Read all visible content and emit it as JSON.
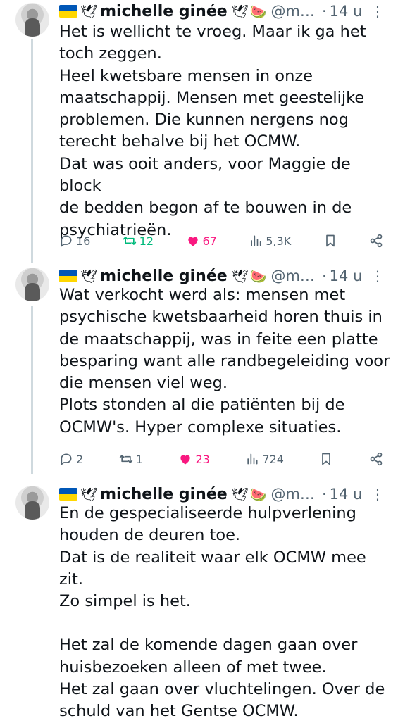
{
  "colors": {
    "text": "#0f1419",
    "muted": "#536471",
    "retweet": "#00ba7c",
    "like": "#f91880",
    "thread_line": "#cfd9de"
  },
  "tweets": [
    {
      "name": "michelle ginée",
      "prefix_icons": [
        "ukraine-flag",
        "dove-olive-icon"
      ],
      "suffix_icons": [
        "dove-icon",
        "watermelon-icon"
      ],
      "handle": "@m…",
      "sep": "·",
      "time": "14 u",
      "lines": [
        "Het is wellicht te vroeg. Maar ik ga het",
        "toch zeggen.",
        "Heel kwetsbare mensen in onze",
        "maatschappij. Mensen met geestelijke",
        "problemen. Die kunnen nergens nog",
        "terecht behalve bij het OCMW.",
        "Dat was ooit anders, voor Maggie de block",
        "de bedden begon af te bouwen in de",
        "psychiatrieën."
      ],
      "replies": "16",
      "retweets": "12",
      "likes": "67",
      "views": "5,3K"
    },
    {
      "name": "michelle ginée",
      "prefix_icons": [
        "ukraine-flag",
        "dove-olive-icon"
      ],
      "suffix_icons": [
        "dove-icon",
        "watermelon-icon"
      ],
      "handle": "@m…",
      "sep": "·",
      "time": "14 u",
      "lines": [
        "Wat verkocht werd als: mensen met",
        "psychische kwetsbaarheid horen thuis in",
        "de maatschappij, was in feite een platte",
        "besparing want alle randbegeleiding voor",
        "die mensen viel weg.",
        "Plots stonden al die patiënten bij de",
        "OCMW's. Hyper complexe situaties."
      ],
      "replies": "2",
      "retweets": "1",
      "likes": "23",
      "views": "724"
    },
    {
      "name": "michelle ginée",
      "prefix_icons": [
        "ukraine-flag",
        "dove-olive-icon"
      ],
      "suffix_icons": [
        "dove-icon",
        "watermelon-icon"
      ],
      "handle": "@m…",
      "sep": "·",
      "time": "14 u",
      "lines": [
        "En de gespecialiseerde hulpverlening",
        "houden de deuren toe.",
        "Dat is de realiteit waar elk OCMW mee zit.",
        "Zo simpel is het.",
        "",
        "Het zal de komende dagen gaan over",
        "huisbezoeken alleen of met twee.",
        "Het zal gaan over vluchtelingen. Over de",
        "schuld van het Gentse OCMW."
      ]
    }
  ]
}
